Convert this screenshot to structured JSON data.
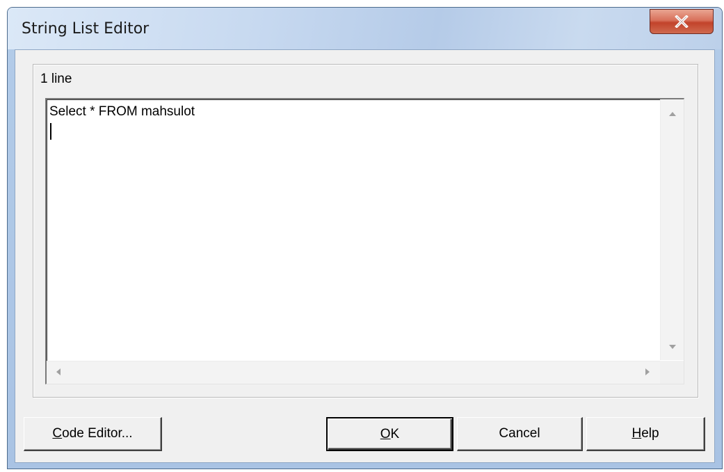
{
  "window": {
    "title": "String List Editor"
  },
  "titlebar": {
    "close_icon": "close-icon"
  },
  "editor": {
    "line_count": "1 line",
    "content": "Select * FROM mahsulot"
  },
  "buttons": {
    "code_editor": {
      "mnemonic": "C",
      "rest": "ode Editor..."
    },
    "ok": {
      "mnemonic": "O",
      "rest": "K"
    },
    "cancel": {
      "label": "Cancel"
    },
    "help": {
      "mnemonic": "H",
      "rest": "elp"
    }
  },
  "colors": {
    "dialog_face": "#f0f0f0",
    "close_button": "#c2432b",
    "frame": "#a9c3e4"
  }
}
